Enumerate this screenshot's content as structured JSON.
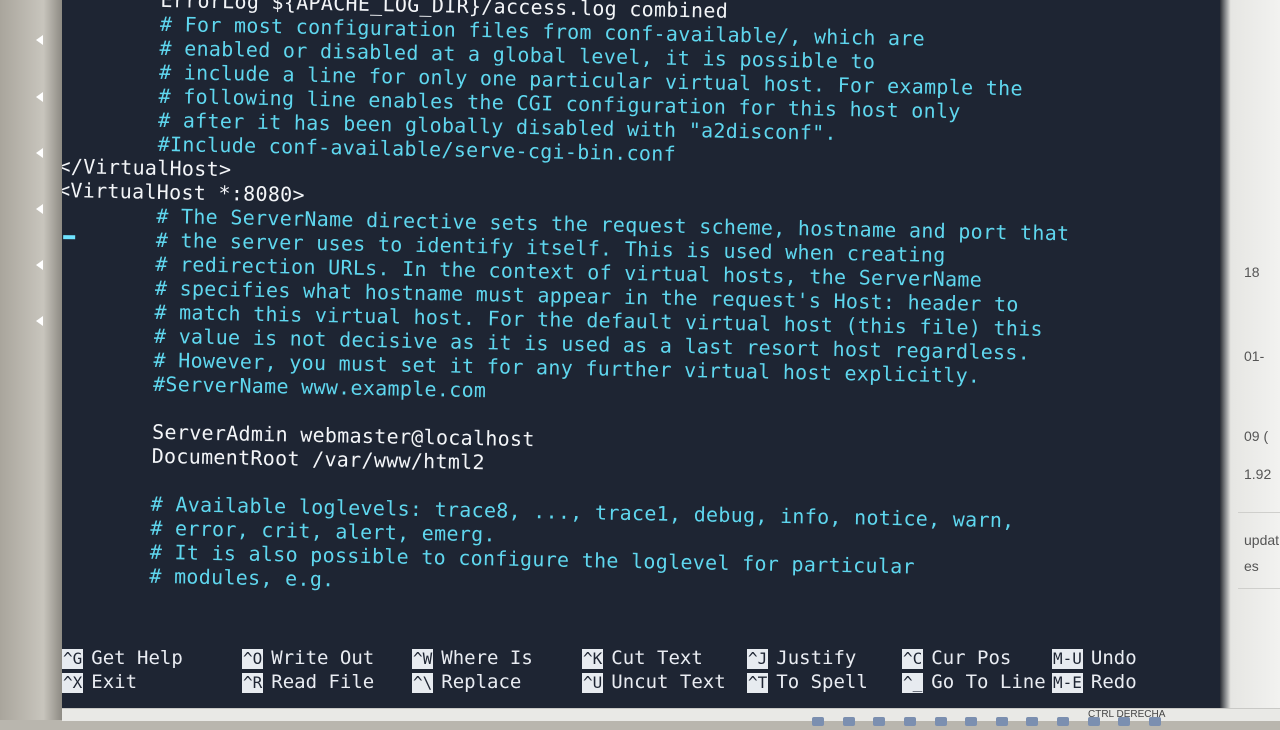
{
  "editor": {
    "lines": [
      {
        "text": "        ErrorLog ${APACHE_LOG_DIR}/access.log combined",
        "kind": "directive"
      },
      {
        "text": "        # For most configuration files from conf-available/, which are",
        "kind": "comment"
      },
      {
        "text": "        # enabled or disabled at a global level, it is possible to",
        "kind": "comment"
      },
      {
        "text": "        # include a line for only one particular virtual host. For example the",
        "kind": "comment"
      },
      {
        "text": "        # following line enables the CGI configuration for this host only",
        "kind": "comment"
      },
      {
        "text": "        # after it has been globally disabled with \"a2disconf\".",
        "kind": "comment"
      },
      {
        "text": "        #Include conf-available/serve-cgi-bin.conf",
        "kind": "comment"
      },
      {
        "text": "</VirtualHost>",
        "kind": "tag"
      },
      {
        "text": "<VirtualHost *:8080>",
        "kind": "tag"
      },
      {
        "text": "        # The ServerName directive sets the request scheme, hostname and port that",
        "kind": "comment"
      },
      {
        "text": "        # the server uses to identify itself. This is used when creating",
        "kind": "comment"
      },
      {
        "text": "        # redirection URLs. In the context of virtual hosts, the ServerName",
        "kind": "comment"
      },
      {
        "text": "        # specifies what hostname must appear in the request's Host: header to",
        "kind": "comment"
      },
      {
        "text": "        # match this virtual host. For the default virtual host (this file) this",
        "kind": "comment"
      },
      {
        "text": "        # value is not decisive as it is used as a last resort host regardless.",
        "kind": "comment"
      },
      {
        "text": "        # However, you must set it for any further virtual host explicitly.",
        "kind": "comment"
      },
      {
        "text": "        #ServerName www.example.com",
        "kind": "comment"
      },
      {
        "text": "",
        "kind": "blank"
      },
      {
        "text": "        ServerAdmin webmaster@localhost",
        "kind": "directive"
      },
      {
        "text": "        DocumentRoot /var/www/html2",
        "kind": "directive"
      },
      {
        "text": "",
        "kind": "blank"
      },
      {
        "text": "        # Available loglevels: trace8, ..., trace1, debug, info, notice, warn,",
        "kind": "comment"
      },
      {
        "text": "        # error, crit, alert, emerg.",
        "kind": "comment"
      },
      {
        "text": "        # It is also possible to configure the loglevel for particular",
        "kind": "comment"
      },
      {
        "text": "        # modules, e.g.",
        "kind": "comment"
      }
    ]
  },
  "shortcuts": [
    {
      "key": "^G",
      "label": "Get Help"
    },
    {
      "key": "^O",
      "label": "Write Out"
    },
    {
      "key": "^W",
      "label": "Where Is"
    },
    {
      "key": "^K",
      "label": "Cut Text"
    },
    {
      "key": "^J",
      "label": "Justify"
    },
    {
      "key": "^C",
      "label": "Cur Pos"
    },
    {
      "key": "M-U",
      "label": "Undo"
    },
    {
      "key": "^X",
      "label": "Exit"
    },
    {
      "key": "^R",
      "label": "Read File"
    },
    {
      "key": "^\\",
      "label": "Replace"
    },
    {
      "key": "^U",
      "label": "Uncut Text"
    },
    {
      "key": "^T",
      "label": "To Spell"
    },
    {
      "key": "^_",
      "label": "Go To Line"
    },
    {
      "key": "M-E",
      "label": "Redo"
    }
  ],
  "background_window": {
    "fragments": [
      "18",
      "01-",
      "09 (",
      "1.92",
      "updat",
      "es"
    ]
  },
  "taskbar": {
    "tray_text": "CTRL DERECHA"
  },
  "colors": {
    "terminal_bg": "#1e2533",
    "comment": "#5fd7ef",
    "text": "#e9ecf2"
  }
}
